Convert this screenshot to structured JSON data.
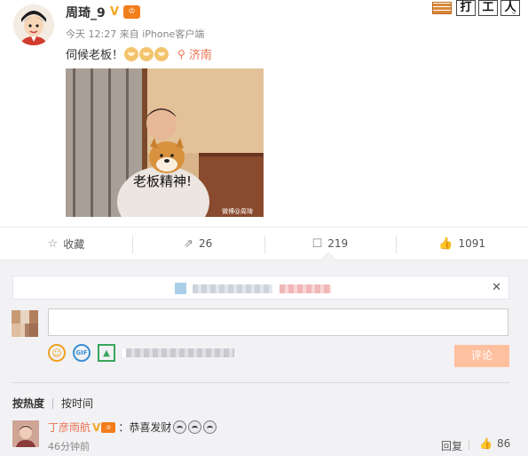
{
  "post": {
    "author": "周琦_9",
    "badge_vip": "V",
    "meta": "今天 12:27 来自 iPhone客户端",
    "text": "伺候老板！",
    "location": "济南",
    "stamp_chars": [
      "打",
      "工",
      "人"
    ],
    "photo": {
      "caption": "老板精神!",
      "watermark": "微博@周琦"
    }
  },
  "actions": {
    "favorite_label": "收藏",
    "repost_count": "26",
    "comment_count": "219",
    "like_count": "1091"
  },
  "comment_box": {
    "submit_label": "评论"
  },
  "sort": {
    "by_heat": "按热度",
    "by_time": "按时间"
  },
  "comment": {
    "author": "丁彦雨航",
    "text": "：恭喜发财",
    "time": "46分钟前",
    "reply_label": "回复",
    "like_count": "86"
  },
  "colors": {
    "accent_orange": "#eb7350",
    "submit_disabled": "#ffc09f",
    "panel_bg": "#f2f2f5"
  },
  "icons": {
    "location": "location-pin-icon",
    "favorite": "star-icon",
    "repost": "repost-icon",
    "comment": "comment-icon",
    "like": "thumbs-up-icon",
    "close": "close-icon",
    "emoji": "emoji-icon",
    "gif": "gif-icon",
    "image": "image-icon",
    "dropdown": "chevron-down-icon"
  }
}
